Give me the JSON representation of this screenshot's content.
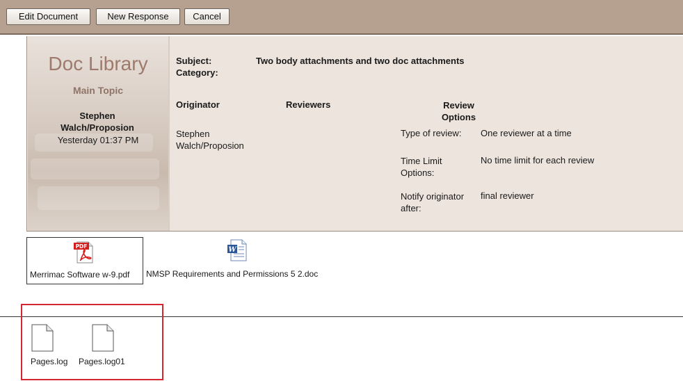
{
  "toolbar": {
    "edit_label": "Edit Document",
    "new_response_label": "New Response",
    "cancel_label": "Cancel"
  },
  "sidebar": {
    "title": "Doc Library",
    "subtitle": "Main Topic",
    "author": "Stephen Walch/Proposion",
    "date": "Yesterday 01:37 PM"
  },
  "document": {
    "subject_label": "Subject:",
    "subject_value": "Two body attachments and two doc attachments",
    "category_label": "Category:",
    "originator_label": "Originator",
    "originator_value": "Stephen Walch/Proposion",
    "reviewers_label": "Reviewers",
    "review_options_label": "Review Options",
    "review_type_label": "Type of review:",
    "review_type_value": "One reviewer at a time",
    "time_limit_label": "Time Limit Options:",
    "time_limit_value": "No time limit for each review",
    "notify_label": "Notify originator after:",
    "notify_value": "final reviewer"
  },
  "body_attachments": [
    {
      "name": "Merrimac Software w-9.pdf",
      "icon": "pdf-file-icon"
    },
    {
      "name": "NMSP Requirements and Permissions 5 2.doc",
      "icon": "word-doc-icon"
    }
  ],
  "doc_attachments": [
    {
      "name": "Pages.log",
      "icon": "generic-file-icon"
    },
    {
      "name": "Pages.log01",
      "icon": "generic-file-icon"
    }
  ],
  "colors": {
    "toolbar": "#b6a190",
    "header_bg": "#ece4dd",
    "title_text": "#9d7a6c",
    "highlight_box": "#d3262e"
  }
}
